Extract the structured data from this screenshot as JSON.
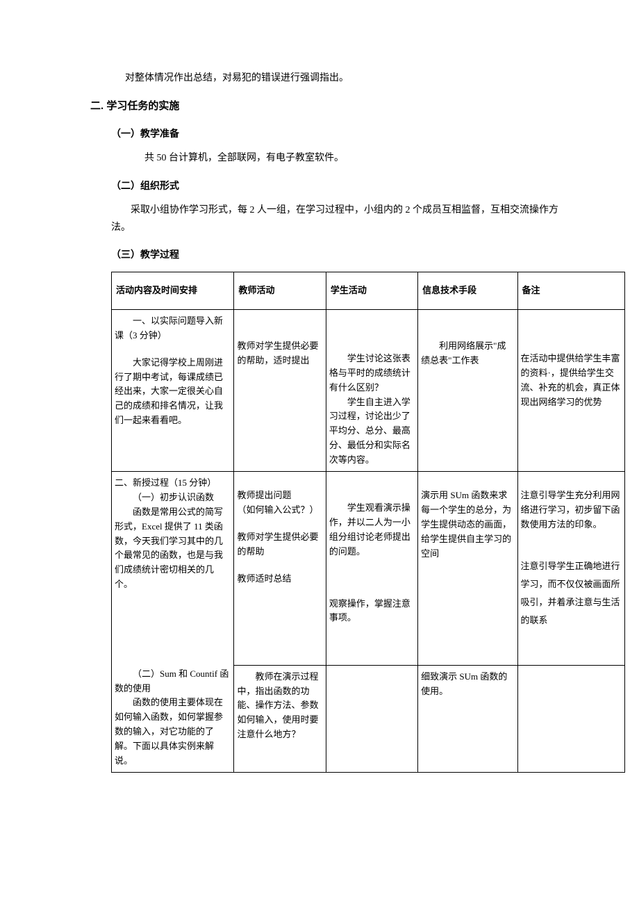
{
  "summary_line": "对整体情况作出总结，对易犯的错误进行强调指出。",
  "h2": "二. 学习任务的实施",
  "sec1": {
    "title": "（一）教学准备",
    "body": "共 50 台计算机，全部联网，有电子教室软件。"
  },
  "sec2": {
    "title": "（二）组织形式",
    "body": "采取小组协作学习形式，每 2 人一组，在学习过程中，小组内的 2 个成员互相监督，互相交流操作方法。"
  },
  "sec3": {
    "title": "（三）教学过程"
  },
  "table": {
    "headers": {
      "c1": "活动内容及时间安排",
      "c2": "教师活动",
      "c3": "学生活动",
      "c4": "信息技术手段",
      "c5": "备注"
    },
    "r1": {
      "c1a": "一、以实际问题导入新课（3 分钟）",
      "c1b": "大家记得学校上周刚进行了期中考试，每课成绩已经出来，大家一定很关心自己的成绩和排名情况，让我们一起来看看吧。",
      "c2": "教师对学生提供必要的帮助，适时提出",
      "c3": "学生讨论这张表格与平时的成绩统计有什么区别？\n　　学生自主进入学习过程，讨论出少了平均分、总分、最高分、最低分和实际名次等内容。",
      "c4": "利用网络展示\"成绩总表\"工作表",
      "c5": "在活动中提供给学生丰富的资料·，提供给学生交流、补充的机会，真正体现出网络学习的优势"
    },
    "r2": {
      "c1a": "二、新授过程（15 分钟）",
      "c1b": "（一）初步认识函数",
      "c1c": "函数是常用公式的简写形式，Excel 提供了 11 类函数，今天我们学习其中的几个最常见的函数，也是与我们成绩统计密切相关的几个。",
      "c1d": "（二）Sum 和 Countif 函数的使用",
      "c1e": "函数的使用主要体现在如何输入函数，如何掌握参数的输入，对它功能的了解。下面以具体实例来解说。",
      "c2a": "教师提出问题\n（如何输入公式？）",
      "c2b": "教师对学生提供必要的帮助",
      "c2c": "教师适时总结",
      "c2d": "教师在演示过程中，指出函数的功能、操作方法、参数如何输入，使用时要注意什么地方？",
      "c3a": "学生观看演示操作，并以二人为一小组分组讨论老师提出的问题。",
      "c3b": "观察操作，掌握注意事项。",
      "c4a": "演示用 SUm 函数来求每一个学生的总分，为学生提供动态的画面，给学生提供自主学习的空间",
      "c4b": "细致演示 SUm 函数的使用。",
      "c5a": "注意引导学生充分利用网络进行学习，初步留下函数使用方法的印象。",
      "c5b": "注意引导学生正确地进行学习，而不仅仅被画面所吸引，并着承注意与生活的联系"
    }
  }
}
